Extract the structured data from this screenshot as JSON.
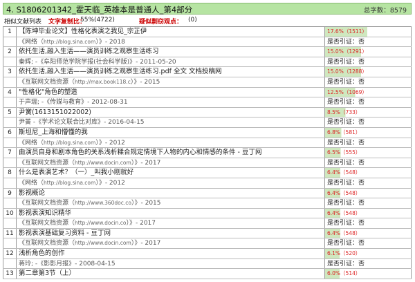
{
  "header": {
    "title": "4. S1806201342_霍天临_英雄本是普通人_第4部分",
    "word_count_label": "总字数：",
    "word_count_value": "8579"
  },
  "summary": {
    "list_label": "相似文献列表",
    "ratio_label": "文字复制比：",
    "ratio_value": "55%(4722)",
    "suspect_label": "疑似剽窃观点：",
    "suspect_value": "(0)"
  },
  "items": [
    {
      "index": "1",
      "title": "【陈坤毕业论文】性格化表演之我见_宗芷伊",
      "pct": "17.6%（1511）",
      "pct_fill": 0.176,
      "src_pre": "《网络（",
      "src_url": "http://blog.sina.com",
      "src_post": "）》- 2018",
      "verdict": "是否引证：否"
    },
    {
      "index": "2",
      "title": "依托生活,融入生活——演员训练之观察生活练习",
      "pct": "15.0%（1291）",
      "pct_fill": 0.15,
      "src_pre": "秦辉; -《阜阳师范学院学报(社会科学版)》- 2011-05-20",
      "src_url": "",
      "src_post": "",
      "verdict": "是否引证：否"
    },
    {
      "index": "3",
      "title": "依托生活,融入生活——演员训练之观察生活练习.pdf 全文 文档投稿网",
      "pct": "15.0%（1288）",
      "pct_fill": 0.15,
      "src_pre": "《互联网文档资源（",
      "src_url": "http://max.book118.c",
      "src_post": "）》- 2015",
      "verdict": "是否引证：否"
    },
    {
      "index": "4",
      "title": "\"性格化\"角色的塑造",
      "pct": "12.5%（1069）",
      "pct_fill": 0.125,
      "src_pre": "于声瑞; -《传媒与教育》- 2012-08-31",
      "src_url": "",
      "src_post": "",
      "verdict": "是否引证：否"
    },
    {
      "index": "5",
      "title": "尹黉(1613151022002)",
      "pct": "8.5%（733）",
      "pct_fill": 0.085,
      "src_pre": "尹黉 -《学术论文联合比对库》- 2016-04-15",
      "src_url": "",
      "src_post": "",
      "verdict": "是否引证：否"
    },
    {
      "index": "6",
      "title": "斯坦尼_上海和懵懂的我",
      "pct": "6.8%（581）",
      "pct_fill": 0.068,
      "src_pre": "《网络（",
      "src_url": "http://blog.sina.com",
      "src_post": "）》- 2012",
      "verdict": "是否引证：否"
    },
    {
      "index": "7",
      "title": "由演员自身和剧本角色的关系浅析糅合规定情境下人物的内心和情感的条件 - 豆丁网",
      "pct": "6.5%（555）",
      "pct_fill": 0.065,
      "src_pre": "《互联网文档资源（",
      "src_url": "http://www.docin.com",
      "src_post": "）》- 2017",
      "verdict": "是否引证：否"
    },
    {
      "index": "8",
      "title": "什么是表演艺术？（一）_叫我小刚就好",
      "pct": "6.4%（548）",
      "pct_fill": 0.064,
      "src_pre": "《网络（",
      "src_url": "http://blog.sina.com",
      "src_post": "）》- 2012",
      "verdict": "是否引证：否"
    },
    {
      "index": "9",
      "title": "影视概论",
      "pct": "6.4%（548）",
      "pct_fill": 0.064,
      "src_pre": "《互联网文档资源（",
      "src_url": "http://www.360doc.co",
      "src_post": "）》- 2015",
      "verdict": "是否引证：否"
    },
    {
      "index": "10",
      "title": "影视表演知识精华",
      "pct": "6.4%（548）",
      "pct_fill": 0.064,
      "src_pre": "《互联网文档资源（",
      "src_url": "http://www.docin.co",
      "src_post": "）》- 2017",
      "verdict": "是否引证：否"
    },
    {
      "index": "11",
      "title": "影视表演基础复习资料 - 豆丁网",
      "pct": "6.4%（548）",
      "pct_fill": 0.064,
      "src_pre": "《互联网文档资源（",
      "src_url": "http://www.docin.com",
      "src_post": "）》- 2017",
      "verdict": "是否引证：否"
    },
    {
      "index": "12",
      "title": "浅析角色的创作",
      "pct": "6.1%（520）",
      "pct_fill": 0.061,
      "src_pre": "蒋玲; -《影影月报》- 2008-04-15",
      "src_url": "",
      "src_post": "",
      "verdict": "是否引证：否"
    },
    {
      "index": "13",
      "title": "第二章第3节（上）",
      "pct": "6.0%（514）",
      "pct_fill": 0.06,
      "src_pre": "",
      "src_url": "",
      "src_post": "",
      "verdict": ""
    }
  ],
  "colors": {
    "header_bg": "#b6e4a2",
    "bar_fill": "#cfe8bf",
    "highlight_red": "#cc0000"
  }
}
